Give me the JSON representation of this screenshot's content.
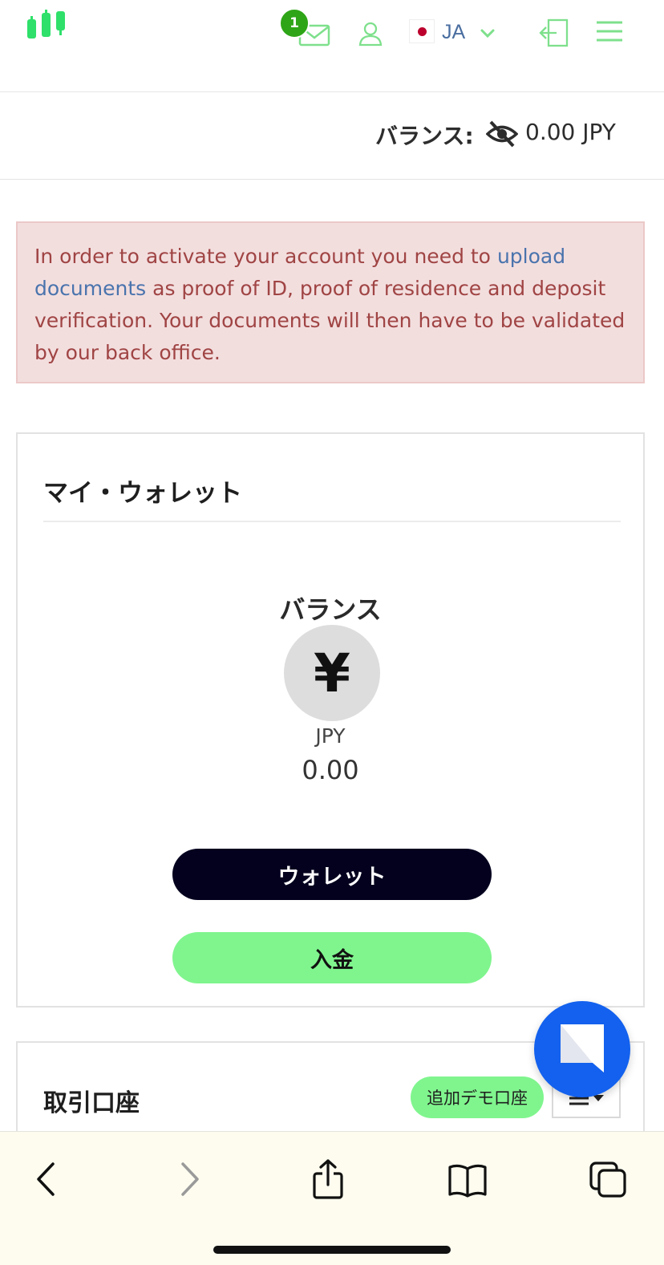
{
  "header": {
    "logo_name": "logo-icon",
    "mail_badge_count": "1",
    "language": "JA",
    "accent_color": "#7ee08c"
  },
  "balance_strip": {
    "label": "バランス:",
    "amount": "0.00 JPY"
  },
  "alert": {
    "text_before": "In order to activate your account you need to ",
    "link_text": "upload documents",
    "text_after": " as proof of ID, proof of residence and deposit verification. Your documents will then have to be validated by our back office."
  },
  "wallet": {
    "title": "マイ・ウォレット",
    "balance_title": "バランス",
    "currency_symbol": "¥",
    "currency": "JPY",
    "value": "0.00",
    "wallet_button": "ウォレット",
    "deposit_button": "入金"
  },
  "trading": {
    "title": "取引口座",
    "add_demo_button": "追加デモ口座"
  },
  "colors": {
    "alert_bg": "#f3dede",
    "alert_text": "#a04444",
    "link": "#4a74ad",
    "dark_button": "#03011e",
    "green_button": "#80f58e",
    "chat_blue": "#1361ee"
  }
}
